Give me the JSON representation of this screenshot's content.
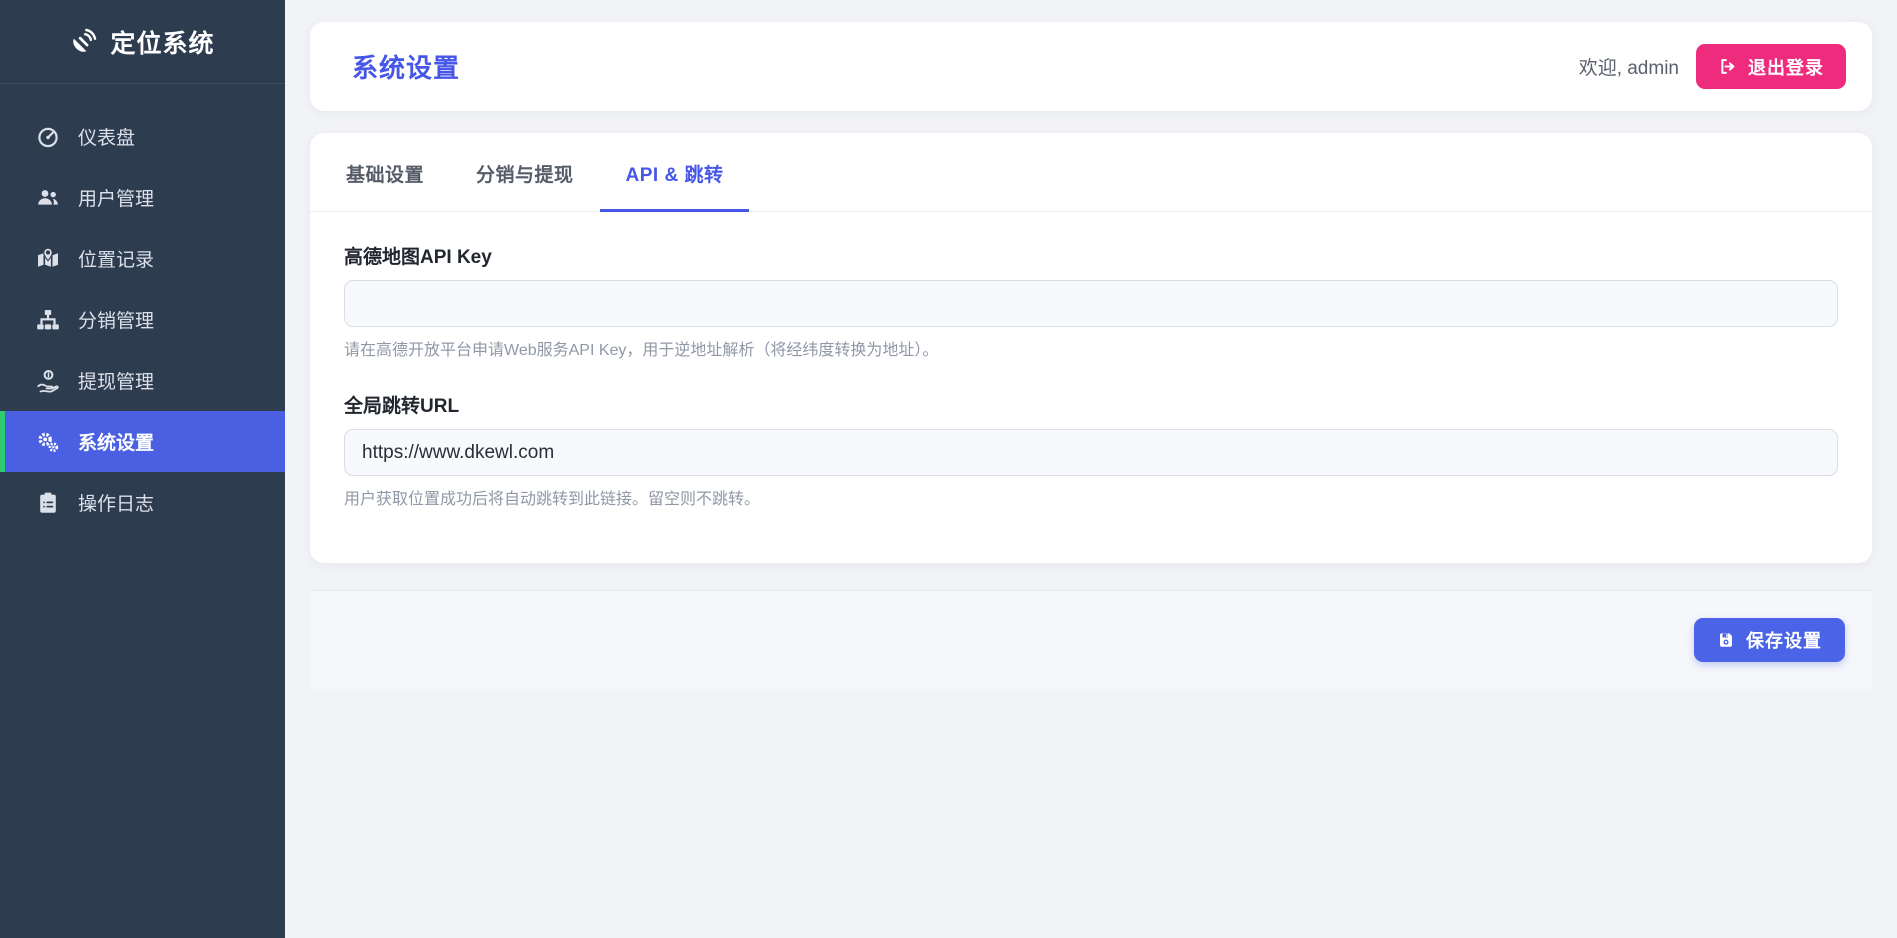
{
  "app": {
    "title": "定位系统"
  },
  "sidebar": {
    "items": [
      {
        "label": "仪表盘",
        "icon": "gauge-icon",
        "active": false
      },
      {
        "label": "用户管理",
        "icon": "users-icon",
        "active": false
      },
      {
        "label": "位置记录",
        "icon": "map-marked-icon",
        "active": false
      },
      {
        "label": "分销管理",
        "icon": "sitemap-icon",
        "active": false
      },
      {
        "label": "提现管理",
        "icon": "hand-holding-dollar-icon",
        "active": false
      },
      {
        "label": "系统设置",
        "icon": "cogs-icon",
        "active": true
      },
      {
        "label": "操作日志",
        "icon": "clipboard-list-icon",
        "active": false
      }
    ]
  },
  "header": {
    "title": "系统设置",
    "welcome": "欢迎, admin",
    "logout_label": "退出登录"
  },
  "tabs": [
    {
      "label": "基础设置",
      "active": false
    },
    {
      "label": "分销与提现",
      "active": false
    },
    {
      "label": "API & 跳转",
      "active": true
    }
  ],
  "form": {
    "amap_api_key": {
      "label": "高德地图API Key",
      "value": "",
      "hint": "请在高德开放平台申请Web服务API Key，用于逆地址解析（将经纬度转换为地址）。"
    },
    "global_redirect_url": {
      "label": "全局跳转URL",
      "value": "https://www.dkewl.com",
      "hint": "用户获取位置成功后将自动跳转到此链接。留空则不跳转。"
    }
  },
  "footer": {
    "save_label": "保存设置"
  },
  "colors": {
    "sidebar_bg": "#2e3c50",
    "sidebar_active_bg": "#4a5fe2",
    "active_accent_green": "#2ecc71",
    "primary_blue": "#4656e8",
    "logout_pink": "#ee2b7d",
    "save_blue": "#4a63e7",
    "page_bg": "#f2f3f7"
  }
}
